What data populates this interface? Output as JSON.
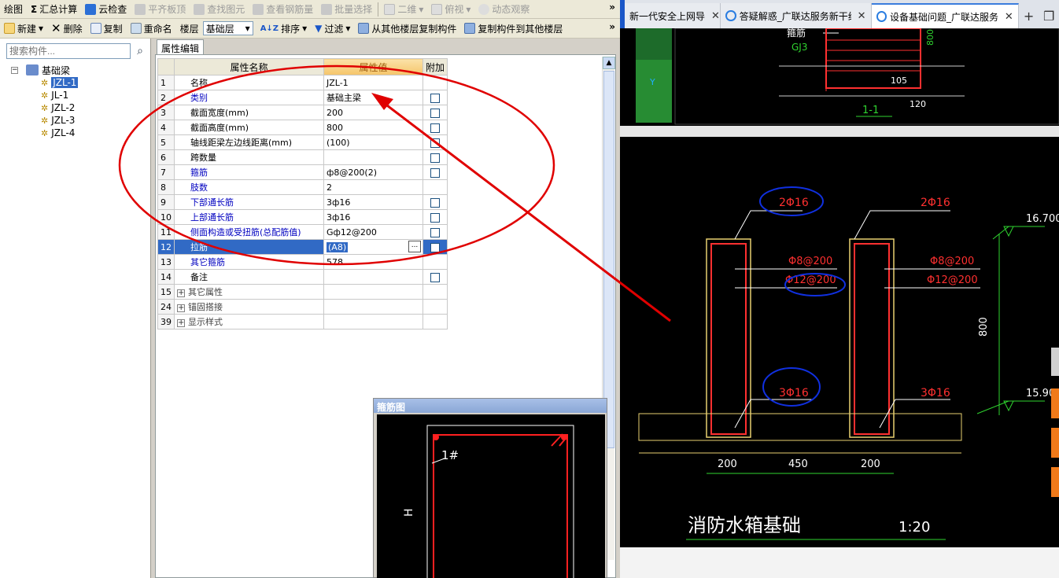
{
  "toolbar1": {
    "items": [
      "绘图",
      "汇总计算",
      "云检查",
      "平齐板顶",
      "查找图元",
      "查看钢筋量",
      "批量选择",
      "二维",
      "俯视",
      "动态观察"
    ],
    "more": "»"
  },
  "toolbar2": {
    "new": "新建",
    "delete": "删除",
    "copy": "复制",
    "rename": "重命名",
    "floor_label": "楼层",
    "floor_value": "基础层",
    "sort": "排序",
    "filter": "过滤",
    "copy_from": "从其他楼层复制构件",
    "copy_to": "复制构件到其他楼层",
    "more": "»"
  },
  "left_panel": {
    "search_placeholder": "搜索构件...",
    "tree_root": "基础梁",
    "tree_items": [
      "JZL-1",
      "JL-1",
      "JZL-2",
      "JZL-3",
      "JZL-4"
    ]
  },
  "property_panel": {
    "tab": "属性编辑",
    "headers": {
      "name": "属性名称",
      "value": "属性值",
      "extra": "附加"
    },
    "rows": [
      {
        "n": "1",
        "name": "名称",
        "value": "JZL-1",
        "blue": false,
        "cb": false
      },
      {
        "n": "2",
        "name": "类别",
        "value": "基础主梁",
        "blue": true,
        "cb": true
      },
      {
        "n": "3",
        "name": "截面宽度(mm)",
        "value": "200",
        "blue": false,
        "cb": true
      },
      {
        "n": "4",
        "name": "截面高度(mm)",
        "value": "800",
        "blue": false,
        "cb": true
      },
      {
        "n": "5",
        "name": "轴线距梁左边线距离(mm)",
        "value": "(100)",
        "blue": false,
        "cb": true
      },
      {
        "n": "6",
        "name": "跨数量",
        "value": "",
        "blue": false,
        "cb": true
      },
      {
        "n": "7",
        "name": "箍筋",
        "value": "ф8@200(2)",
        "blue": true,
        "cb": true
      },
      {
        "n": "8",
        "name": "肢数",
        "value": "2",
        "blue": true,
        "cb": false
      },
      {
        "n": "9",
        "name": "下部通长筋",
        "value": "3ф16",
        "blue": true,
        "cb": true
      },
      {
        "n": "10",
        "name": "上部通长筋",
        "value": "3ф16",
        "blue": true,
        "cb": true
      },
      {
        "n": "11",
        "name": "侧面构造或受扭筋(总配筋值)",
        "value": "Gф12@200",
        "blue": true,
        "cb": true
      },
      {
        "n": "12",
        "name": "拉筋",
        "value": "(A8)",
        "blue": true,
        "cb": true
      },
      {
        "n": "13",
        "name": "其它箍筋",
        "value": "578",
        "blue": true,
        "cb": false
      },
      {
        "n": "14",
        "name": "备注",
        "value": "",
        "blue": false,
        "cb": true
      },
      {
        "n": "15",
        "name": "其它属性",
        "value": "",
        "blue": false,
        "cb": false
      },
      {
        "n": "24",
        "name": "锚固搭接",
        "value": "",
        "blue": false,
        "cb": false
      },
      {
        "n": "39",
        "name": "显示样式",
        "value": "",
        "blue": false,
        "cb": false
      }
    ],
    "ellipsis": "..."
  },
  "rebar_window": {
    "title": "箍筋图",
    "label_1": "1#",
    "label_h": "H"
  },
  "browser": {
    "tabs": [
      "新一代安全上网导",
      "答疑解惑_广联达服务新干线",
      "设备基础问题_广联达服务新干线"
    ],
    "new_tab": "+"
  },
  "cad_top": {
    "stirrup_label": "箍筋",
    "gj_label": "GJ3",
    "dim_800": "800",
    "dim_105": "105",
    "dim_120": "120",
    "section": "1-1"
  },
  "cad_main": {
    "top_bar_left": "2Φ16",
    "top_bar_right": "2Φ16",
    "stirrup_left": "Φ8@200",
    "stirrup_right": "Φ8@200",
    "side_left": "Φ12@200",
    "side_right": "Φ12@200",
    "bottom_left": "3Φ16",
    "bottom_right": "3Φ16",
    "elev_top": "16.700",
    "elev_bottom": "15.90",
    "height_dim": "800",
    "dim_a": "200",
    "dim_b": "450",
    "dim_c": "200",
    "title": "消防水箱基础",
    "scale": "1:20"
  },
  "colors": {
    "accent": "#316ac5",
    "cad_red": "#ff3030",
    "annotation_red": "#e00000",
    "annotation_blue": "#1030e0"
  }
}
